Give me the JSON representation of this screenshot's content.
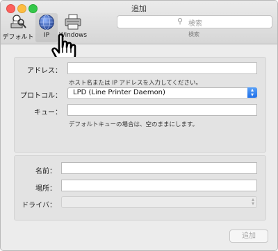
{
  "window": {
    "title": "追加"
  },
  "toolbar": {
    "default_label": "デフォルト",
    "ip_label": "IP",
    "windows_label": "Windows",
    "search_placeholder": "検索",
    "search_caption": "検索"
  },
  "form": {
    "address_label": "アドレス：",
    "address_value": "",
    "address_hint": "ホスト名または IP アドレスを入力してください。",
    "protocol_label": "プロトコル：",
    "protocol_value": "LPD (Line Printer Daemon)",
    "queue_label": "キュー：",
    "queue_value": "",
    "queue_hint": "デフォルトキューの場合は、空のままにします。"
  },
  "details": {
    "name_label": "名前：",
    "location_label": "場所：",
    "driver_label": "ドライバ："
  },
  "footer": {
    "add_label": "追加"
  },
  "colors": {
    "accent": "#2b7cf0",
    "close": "#fc605c",
    "minimize": "#fdbc40",
    "zoom": "#34c84a"
  },
  "icons": [
    "default-printer-icon",
    "ip-globe-icon",
    "windows-printer-icon",
    "search-icon",
    "pointer-hand-icon",
    "popup-arrows-icon"
  ]
}
